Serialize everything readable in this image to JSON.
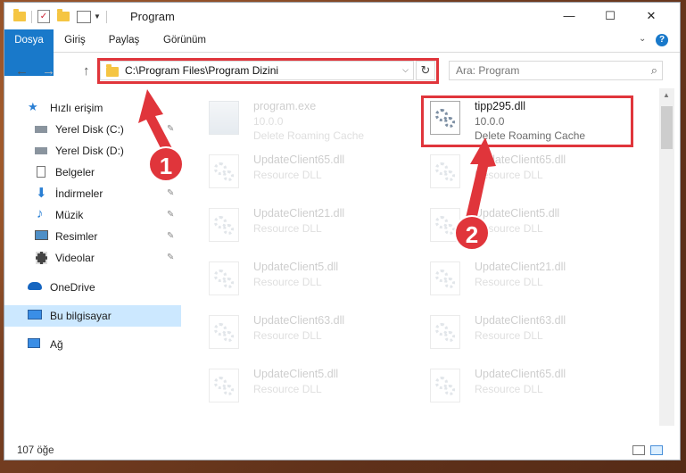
{
  "window": {
    "title": "Program",
    "controls": {
      "minimize": "—",
      "maximize": "☐",
      "close": "✕"
    }
  },
  "ribbon": {
    "tabs": [
      "Dosya",
      "Giriş",
      "Paylaş",
      "Görünüm"
    ],
    "expand_glyph": "⌄",
    "help_glyph": "?"
  },
  "address": {
    "back": "←",
    "forward": "→",
    "up": "↑",
    "path": "C:\\Program Files\\Program Dizini",
    "refresh": "↻",
    "search_placeholder": "Ara: Program",
    "search_glyph": "⌕"
  },
  "sidebar": {
    "items": [
      {
        "label": "Hızlı erişim",
        "icon": "star-icon"
      },
      {
        "label": "Yerel Disk (C:)",
        "icon": "drive-icon"
      },
      {
        "label": "Yerel Disk (D:)",
        "icon": "drive-icon"
      },
      {
        "label": "Belgeler",
        "icon": "documents-icon"
      },
      {
        "label": "İndirmeler",
        "icon": "download-icon"
      },
      {
        "label": "Müzik",
        "icon": "music-icon"
      },
      {
        "label": "Resimler",
        "icon": "pictures-icon"
      },
      {
        "label": "Videolar",
        "icon": "video-icon"
      },
      {
        "label": "OneDrive",
        "icon": "cloud-icon"
      },
      {
        "label": "Bu bilgisayar",
        "icon": "computer-icon"
      },
      {
        "label": "Ağ",
        "icon": "network-icon"
      }
    ],
    "pin_glyph": "📌"
  },
  "files": [
    {
      "name": "program.exe",
      "version": "10.0.0",
      "description": "Delete Roaming Cache",
      "type": "exe",
      "faded": true
    },
    {
      "name": "tipp295.dll",
      "version": "10.0.0",
      "description": "Delete Roaming Cache",
      "type": "dll",
      "faded": false
    },
    {
      "name": "UpdateClient65.dll",
      "description": "Resource DLL",
      "type": "dll",
      "faded": true
    },
    {
      "name": "UpdateClient65.dll",
      "description": "Resource DLL",
      "type": "dll",
      "faded": true
    },
    {
      "name": "UpdateClient21.dll",
      "description": "Resource DLL",
      "type": "dll",
      "faded": true
    },
    {
      "name": "UpdateClient5.dll",
      "description": "Resource DLL",
      "type": "dll",
      "faded": true
    },
    {
      "name": "UpdateClient5.dll",
      "description": "Resource DLL",
      "type": "dll",
      "faded": true
    },
    {
      "name": "UpdateClient21.dll",
      "description": "Resource DLL",
      "type": "dll",
      "faded": true
    },
    {
      "name": "UpdateClient63.dll",
      "description": "Resource DLL",
      "type": "dll",
      "faded": true
    },
    {
      "name": "UpdateClient63.dll",
      "description": "Resource DLL",
      "type": "dll",
      "faded": true
    },
    {
      "name": "UpdateClient5.dll",
      "description": "Resource DLL",
      "type": "dll",
      "faded": true
    },
    {
      "name": "UpdateClient65.dll",
      "description": "Resource DLL",
      "type": "dll",
      "faded": true
    }
  ],
  "status": {
    "count": "107 öğe"
  },
  "annotations": {
    "callout_1": "1",
    "callout_2": "2",
    "highlight_color": "#e0353b"
  }
}
